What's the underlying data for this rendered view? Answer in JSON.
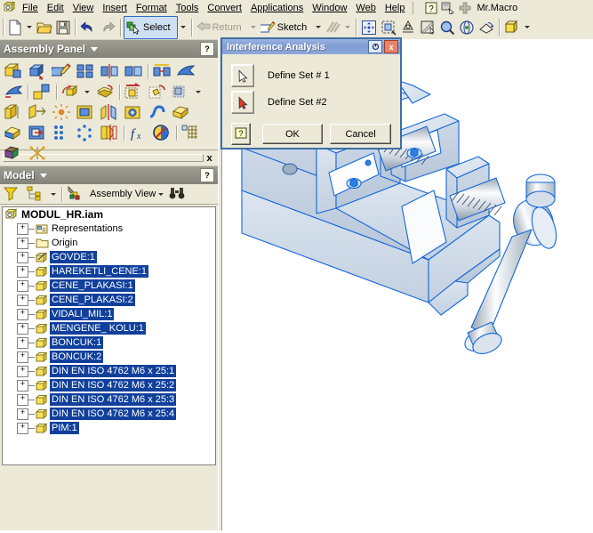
{
  "menu": {
    "app_icon": "inventor-assembly-icon",
    "items": [
      "File",
      "Edit",
      "View",
      "Insert",
      "Format",
      "Tools",
      "Convert",
      "Applications",
      "Window",
      "Web",
      "Help"
    ],
    "right_icons": [
      "help-question-icon",
      "macro-icon",
      "plus-icon"
    ],
    "macro_label": "Mr.Macro"
  },
  "toolbar": {
    "new_label": "new-file-icon",
    "open_label": "open-folder-icon",
    "save_label": "save-disk-icon",
    "undo_label": "undo-arrow-icon",
    "redo_label": "redo-arrow-icon",
    "select_label": "Select",
    "return_label": "Return",
    "sketch_label": "Sketch",
    "view_icons": [
      "pan-icon",
      "zoom-window-icon",
      "look-at-icon",
      "shaded-display-icon",
      "zoom-icon",
      "orbit-icon",
      "rotate-icon",
      "view-cube-icon"
    ]
  },
  "assembly_panel": {
    "title": "Assembly Panel",
    "help": "?",
    "rows": [
      [
        "place-component",
        "create-component",
        "edit-sketch",
        "pattern-component",
        "mirror-component",
        "copy-component",
        "replace-component",
        "move-component"
      ],
      [
        "rotate-component",
        "constraint",
        "assemble-rotate",
        "tweak-components",
        "create-bom",
        "design-view",
        "presentation-view"
      ],
      [
        "cross-section",
        "open-flush",
        "point-cloud",
        "frame-member",
        "mirror-assembly",
        "view-rep",
        "bend-part",
        "shell-part"
      ],
      [
        "color-part",
        "derive-part",
        "bolted-connection",
        "bolt-pattern",
        "mirror-features",
        "parameters-fx",
        "interference-analysis",
        "drive-constraint"
      ],
      [
        "stress-analysis",
        "joint-network"
      ]
    ]
  },
  "model_panel": {
    "title": "Model",
    "help": "?",
    "filter_icon": "filter-funnel-icon",
    "hierarchy_icon": "hierarchy-icon",
    "view_label": "Assembly View",
    "find_icon": "binoculars-icon",
    "close_label": "x"
  },
  "tree": {
    "root": {
      "label": "MODUL_HR.iam",
      "icon": "assembly-doc-icon"
    },
    "items": [
      {
        "label": "Representations",
        "icon": "representations-folder-icon",
        "selected": false,
        "expandable": true
      },
      {
        "label": "Origin",
        "icon": "origin-folder-icon",
        "selected": false,
        "expandable": true
      },
      {
        "label": "GOVDE:1",
        "icon": "part-sketch-icon",
        "selected": true,
        "expandable": true
      },
      {
        "label": "HAREKETLI_CENE:1",
        "icon": "part-icon",
        "selected": true,
        "expandable": true
      },
      {
        "label": "CENE_PLAKASI:1",
        "icon": "part-icon",
        "selected": true,
        "expandable": true
      },
      {
        "label": "CENE_PLAKASI:2",
        "icon": "part-icon",
        "selected": true,
        "expandable": true
      },
      {
        "label": "VIDALI_MIL:1",
        "icon": "part-icon",
        "selected": true,
        "expandable": true
      },
      {
        "label": "MENGENE_ KOLU:1",
        "icon": "part-icon",
        "selected": true,
        "expandable": true
      },
      {
        "label": "BONCUK:1",
        "icon": "part-icon",
        "selected": true,
        "expandable": true
      },
      {
        "label": "BONCUK:2",
        "icon": "part-icon",
        "selected": true,
        "expandable": true
      },
      {
        "label": "DIN EN ISO 4762  M6 x 25:1",
        "icon": "part-icon",
        "selected": true,
        "expandable": true
      },
      {
        "label": "DIN EN ISO 4762  M6 x 25:2",
        "icon": "part-icon",
        "selected": true,
        "expandable": true
      },
      {
        "label": "DIN EN ISO 4762  M6 x 25:3",
        "icon": "part-icon",
        "selected": true,
        "expandable": true
      },
      {
        "label": "DIN EN ISO 4762  M6 x 25:4",
        "icon": "part-icon",
        "selected": true,
        "expandable": true
      },
      {
        "label": "PIM:1",
        "icon": "part-icon",
        "selected": true,
        "expandable": true
      }
    ]
  },
  "dialog": {
    "title": "Interference Analysis",
    "rollup_label": "roll-up-icon",
    "close_label": "x",
    "set1_label": "Define Set # 1",
    "set2_label": "Define Set #2",
    "help_label": "?",
    "ok_label": "OK",
    "cancel_label": "Cancel"
  },
  "graphics": {
    "model_name": "machine-vise-assembly",
    "selection_color": "#1668d8",
    "background": "#ffffff"
  },
  "colors": {
    "window_face": "#ece9d8",
    "panel_header": "#8d8d82",
    "tree_selection": "#10409c",
    "dialog_border": "#3d6ea5"
  }
}
